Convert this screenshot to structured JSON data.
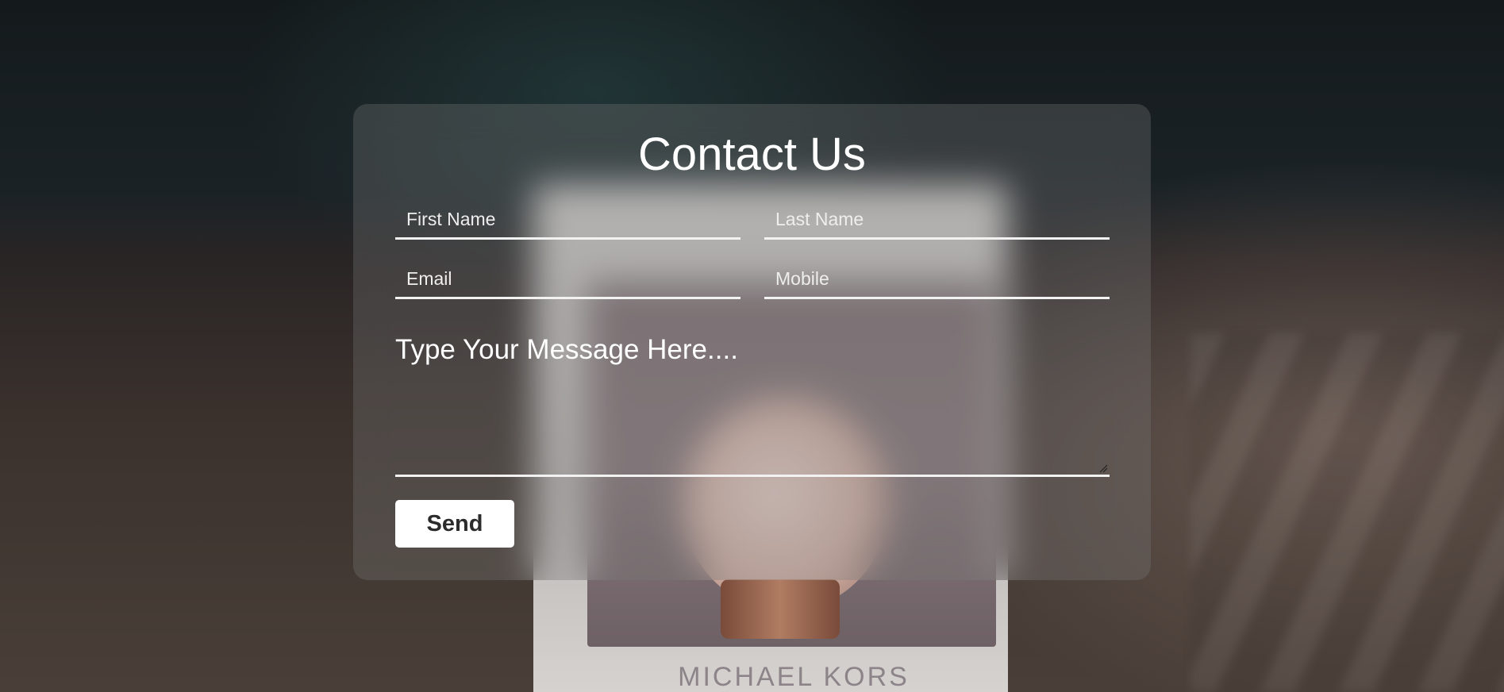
{
  "background": {
    "brand_text": "MICHAEL KORS"
  },
  "form": {
    "title": "Contact Us",
    "first_name_placeholder": "First Name",
    "last_name_placeholder": "Last Name",
    "email_placeholder": "Email",
    "mobile_placeholder": "Mobile",
    "message_placeholder": "Type Your Message Here....",
    "send_label": "Send"
  },
  "colors": {
    "card_overlay": "#787878",
    "underline": "#f2f2f2",
    "button_bg": "#ffffff",
    "button_text": "#2b2b2b"
  }
}
